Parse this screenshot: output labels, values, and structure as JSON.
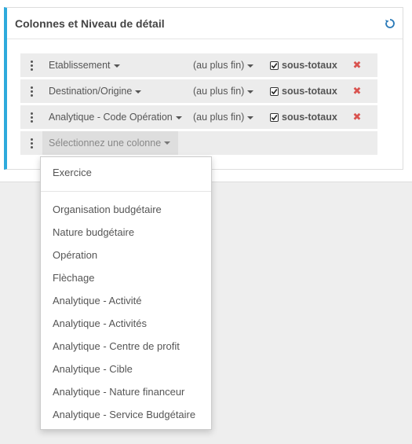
{
  "panel": {
    "title": "Colonnes et Niveau de détail",
    "refresh_icon": "refresh-icon",
    "accent_color": "#2eaadc"
  },
  "rows": [
    {
      "column": "Etablissement",
      "level": "(au plus fin)",
      "subtotals_checked": true,
      "subtotals_label": "sous-totaux"
    },
    {
      "column": "Destination/Origine",
      "level": "(au plus fin)",
      "subtotals_checked": true,
      "subtotals_label": "sous-totaux"
    },
    {
      "column": "Analytique - Code Opération",
      "level": "(au plus fin)",
      "subtotals_checked": true,
      "subtotals_label": "sous-totaux"
    }
  ],
  "new_row": {
    "placeholder": "Sélectionnez une colonne"
  },
  "dropdown": {
    "first_item": "Exercice",
    "items": [
      "Organisation budgétaire",
      "Nature budgétaire",
      "Opération",
      "Flèchage",
      "Analytique - Activité",
      "Analytique - Activités",
      "Analytique - Centre de profit",
      "Analytique - Cible",
      "Analytique - Nature financeur",
      "Analytique - Service Budgétaire"
    ]
  },
  "colors": {
    "remove": "#d9534f",
    "row_bg": "#ececec"
  }
}
